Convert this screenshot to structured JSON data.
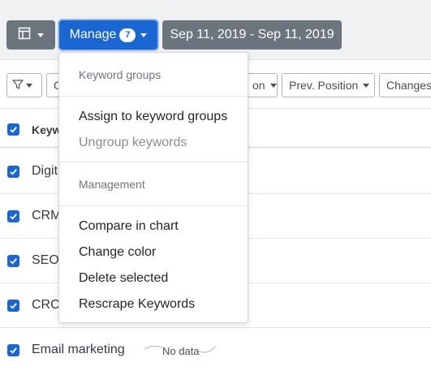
{
  "toolbar": {
    "view_icon": "table-icon",
    "manage_label": "Manage",
    "manage_count": "7",
    "date_range": "Sep 11, 2019 - Sep 11, 2019"
  },
  "filters": {
    "filter_icon": "filter-icon",
    "partial_c": "C",
    "position_partial": "on",
    "prev_position": "Prev. Position",
    "changes": "Changes"
  },
  "table": {
    "header_keyword": "Keyw",
    "rows": [
      {
        "keyword": "Digit"
      },
      {
        "keyword": "CRM"
      },
      {
        "keyword": "SEO"
      },
      {
        "keyword": "CRO"
      },
      {
        "keyword": "Email marketing",
        "trend": "No data"
      }
    ]
  },
  "manage_menu": {
    "keyword_groups_header": "Keyword groups",
    "assign_label": "Assign to keyword groups",
    "ungroup_label": "Ungroup keywords",
    "management_header": "Management",
    "compare_label": "Compare in chart",
    "color_label": "Change color",
    "delete_label": "Delete selected",
    "rescrape_label": "Rescrape Keywords"
  },
  "colors": {
    "primary": "#1a66d2",
    "secondary": "#6c757d"
  }
}
